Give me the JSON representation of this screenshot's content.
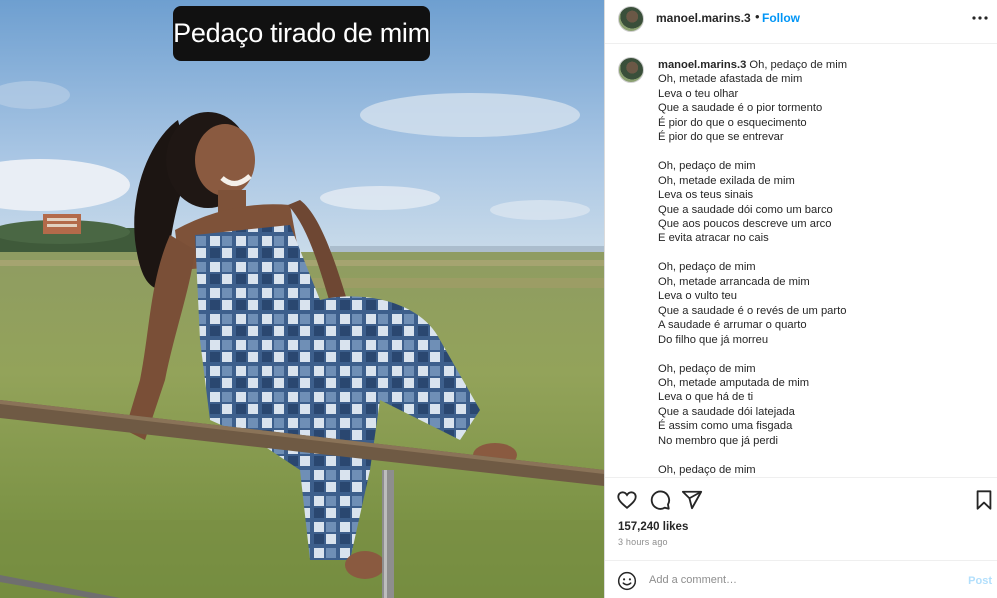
{
  "media": {
    "story_caption": "Pedaço tirado de mim"
  },
  "header": {
    "username": "manoel.marins.3",
    "separator": "•",
    "follow_label": "Follow"
  },
  "caption": {
    "username": "manoel.marins.3",
    "first_line": "Oh, pedaço de mim",
    "body": "Oh, metade afastada de mim\nLeva o teu olhar\nQue a saudade é o pior tormento\nÉ pior do que o esquecimento\nÉ pior do que se entrevar\n\nOh, pedaço de mim\nOh, metade exilada de mim\nLeva os teus sinais\nQue a saudade dói como um barco\nQue aos poucos descreve um arco\nE evita atracar no cais\n\nOh, pedaço de mim\nOh, metade arrancada de mim\nLeva o vulto teu\nQue a saudade é o revés de um parto\nA saudade é arrumar o quarto\nDo filho que já morreu\n\nOh, pedaço de mim\nOh, metade amputada de mim\nLeva o que há de ti\nQue a saudade dói latejada\nÉ assim como uma fisgada\nNo membro que já perdi\n\nOh, pedaço de mim"
  },
  "actions": {
    "like_icon": "heart-icon",
    "comment_icon": "comment-icon",
    "share_icon": "share-icon",
    "save_icon": "bookmark-icon"
  },
  "likes": "157,240 likes",
  "timestamp": "3 hours ago",
  "comment_box": {
    "placeholder": "Add a comment…",
    "post_label": "Post"
  },
  "colors": {
    "accent": "#0095f6",
    "post_disabled": "#b2dffc",
    "secondary_text": "#8e8e8e"
  }
}
